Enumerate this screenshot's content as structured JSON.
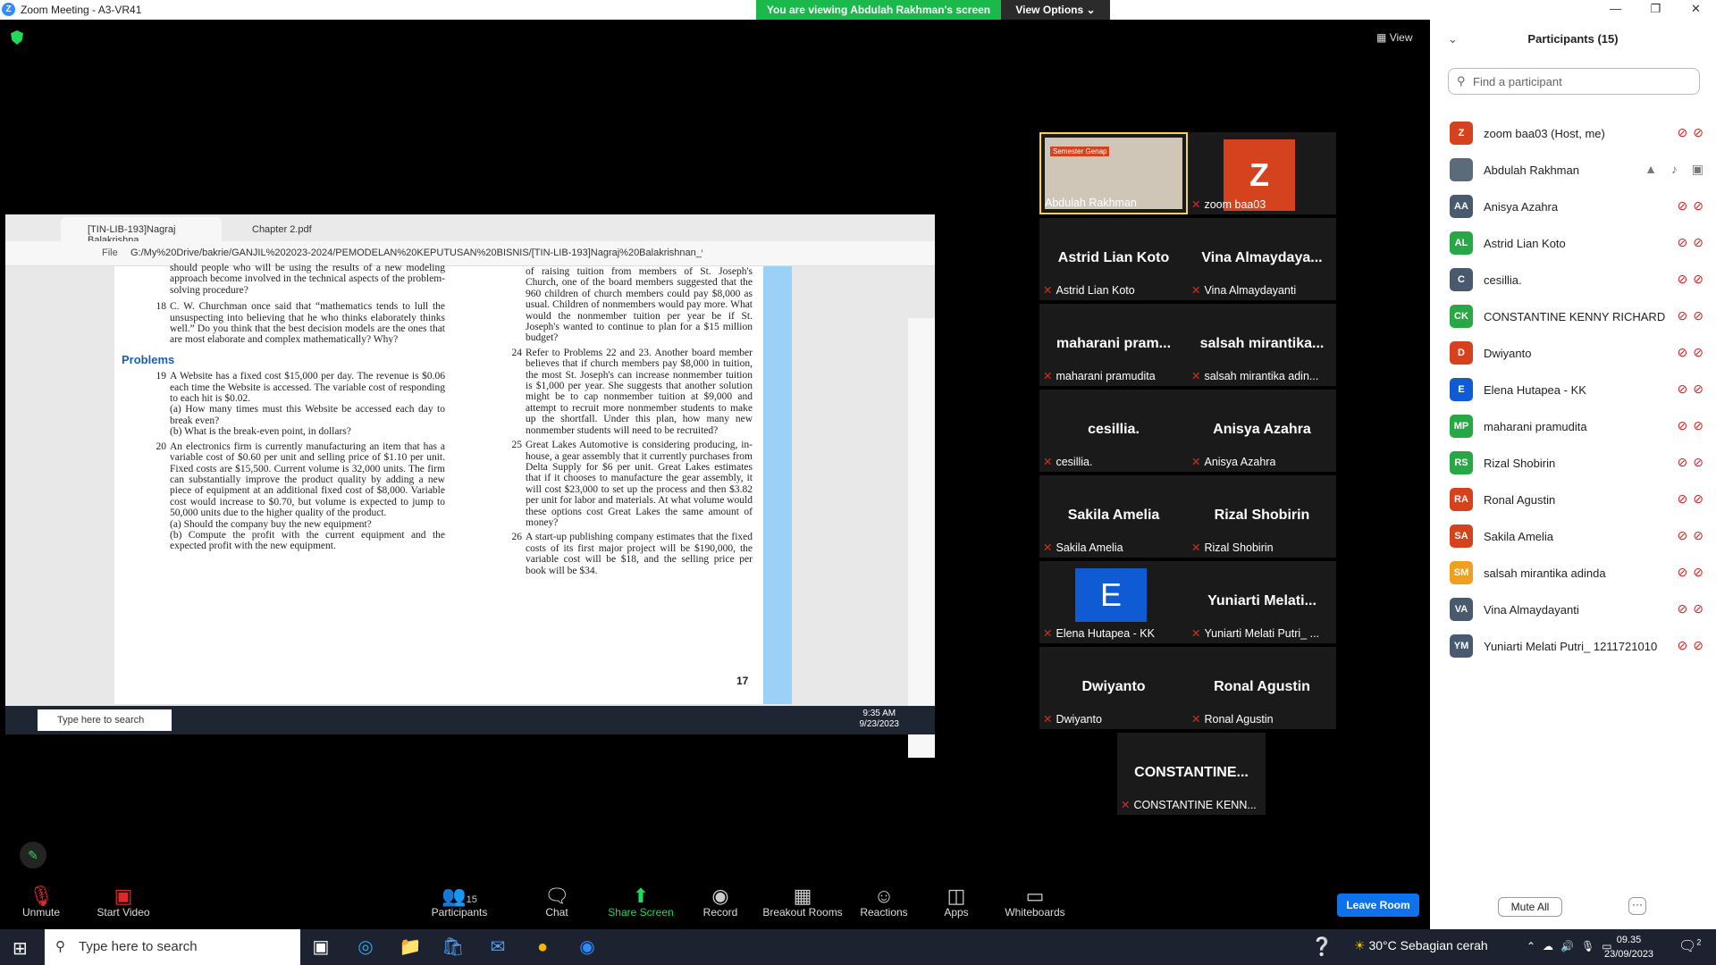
{
  "window": {
    "title": "Zoom Meeting - A3-VR41",
    "app_icon": "Z"
  },
  "banner": {
    "viewing": "You are viewing Abdulah Rakhman's screen",
    "view_options": "View Options"
  },
  "view_label": "View",
  "browser": {
    "tab1": "[TIN-LIB-193]Nagraj Balakrishna...",
    "tab2": "Chapter 2.pdf",
    "file_label": "File",
    "address": "G:/My%20Drive/bakrie/GANJIL%202023-2024/PEMODELAN%20KEPUTUSAN%20BISNIS/[TIN-LIB-193]Nagraj%20Balakrishnan_%20B..."
  },
  "pdf": {
    "left_top": "should people who will be using the results of a new modeling approach become involved in the technical aspects of the problem-solving procedure?",
    "item18_num": "18",
    "item18": "C. W. Churchman once said that “mathematics tends to lull the unsuspecting into believing that he who thinks elaborately thinks well.” Do you think that the best decision models are the ones that are most elaborate and complex mathematically? Why?",
    "problems_heading": "Problems",
    "item19_num": "19",
    "item19": "A Website has a fixed cost $15,000 per day. The revenue is $0.06 each time the Website is accessed. The variable cost of responding to each hit is $0.02.",
    "item19a": "(a) How many times must this Website be accessed each day to break even?",
    "item19b": "(b) What is the break-even point, in dollars?",
    "item20_num": "20",
    "item20": "An electronics firm is currently manufacturing an item that has a variable cost of $0.60 per unit and selling price of $1.10 per unit. Fixed costs are $15,500. Current volume is 32,000 units. The firm can substantially improve the product quality by adding a new piece of equipment at an additional fixed cost of $8,000. Variable cost would increase to $0.70, but volume is expected to jump to 50,000 units due to the higher quality of the product.",
    "item20a": "(a) Should the company buy the new equipment?",
    "item20b": "(b) Compute the profit with the current equipment and the expected profit with the new equipment.",
    "right_top": "of raising tuition from members of St. Joseph's Church, one of the board members suggested that the 960 children of church members could pay $8,000 as usual. Children of nonmembers would pay more. What would the nonmember tuition per year be if St. Joseph's wanted to continue to plan for a $15 million budget?",
    "item24_num": "24",
    "item24": "Refer to Problems 22 and 23. Another board member believes that if church members pay $8,000 in tuition, the most St. Joseph's can increase nonmember tuition is $1,000 per year. She suggests that another solution might be to cap nonmember tuition at $9,000 and attempt to recruit more nonmember students to make up the shortfall. Under this plan, how many new nonmember students will need to be recruited?",
    "item25_num": "25",
    "item25": "Great Lakes Automotive is considering producing, in-house, a gear assembly that it currently purchases from Delta Supply for $6 per unit. Great Lakes estimates that if it chooses to manufacture the gear assembly, it will cost $23,000 to set up the process and then $3.82 per unit for labor and materials. At what volume would these options cost Great Lakes the same amount of money?",
    "item26_num": "26",
    "item26": "A start-up publishing company estimates that the fixed costs of its first major project will be $190,000, the variable cost will be $18, and the selling price per book will be $34.",
    "page_number": "17"
  },
  "inner_taskbar": {
    "search": "Type here to search",
    "time": "9:35 AM",
    "date": "9/23/2023"
  },
  "gallery": [
    {
      "big": "",
      "label": "Abdulah Rakhman"
    },
    {
      "big": "Z",
      "label": "zoom baa03"
    },
    {
      "big": "Astrid Lian Koto",
      "label": "Astrid Lian Koto"
    },
    {
      "big": "Vina  Almaydaya...",
      "label": "Vina Almaydayanti"
    },
    {
      "big": "maharani  pram...",
      "label": "maharani pramudita"
    },
    {
      "big": "salsah  mirantika...",
      "label": "salsah mirantika adin..."
    },
    {
      "big": "cesillia.",
      "label": "cesillia."
    },
    {
      "big": "Anisya Azahra",
      "label": "Anisya Azahra"
    },
    {
      "big": "Sakila Amelia",
      "label": "Sakila Amelia"
    },
    {
      "big": "Rizal Shobirin",
      "label": "Rizal Shobirin"
    },
    {
      "big": "E",
      "label": "Elena Hutapea - KK"
    },
    {
      "big": "Yuniarti  Melati...",
      "label": "Yuniarti Melati Putri_ ..."
    },
    {
      "big": "Dwiyanto",
      "label": "Dwiyanto"
    },
    {
      "big": "Ronal Agustin",
      "label": "Ronal Agustin"
    },
    {
      "big": "CONSTANTINE...",
      "label": "CONSTANTINE KENN..."
    }
  ],
  "thumb_text": "Semester Genap",
  "participants": {
    "title": "Participants (15)",
    "search_placeholder": "Find a participant",
    "list": [
      {
        "initials": "Z",
        "name": "zoom baa03 (Host, me)",
        "color": "#d5431e"
      },
      {
        "initials": "",
        "name": "Abdulah Rakhman",
        "color": "#5b6b7a"
      },
      {
        "initials": "AA",
        "name": "Anisya Azahra",
        "color": "#4a5a6e"
      },
      {
        "initials": "AL",
        "name": "Astrid Lian Koto",
        "color": "#27a844"
      },
      {
        "initials": "C",
        "name": "cesillia.",
        "color": "#4a5a6e"
      },
      {
        "initials": "CK",
        "name": "CONSTANTINE KENNY RICHARD",
        "color": "#27a844"
      },
      {
        "initials": "D",
        "name": "Dwiyanto",
        "color": "#d5431e"
      },
      {
        "initials": "E",
        "name": "Elena Hutapea - KK",
        "color": "#0e5bd3"
      },
      {
        "initials": "MP",
        "name": "maharani pramudita",
        "color": "#27a844"
      },
      {
        "initials": "RS",
        "name": "Rizal Shobirin",
        "color": "#27a844"
      },
      {
        "initials": "RA",
        "name": "Ronal Agustin",
        "color": "#d5431e"
      },
      {
        "initials": "SA",
        "name": "Sakila Amelia",
        "color": "#d5431e"
      },
      {
        "initials": "SM",
        "name": "salsah mirantika adinda",
        "color": "#f0a020"
      },
      {
        "initials": "VA",
        "name": "Vina Almaydayanti",
        "color": "#4a5a6e"
      },
      {
        "initials": "YM",
        "name": "Yuniarti Melati Putri_ 1211721010",
        "color": "#4a5a6e"
      }
    ],
    "mute_all": "Mute All",
    "more": "···"
  },
  "toolbar": {
    "unmute": "Unmute",
    "start_video": "Start Video",
    "participants_count": "15",
    "participants": "Participants",
    "chat": "Chat",
    "share": "Share Screen",
    "record": "Record",
    "breakout": "Breakout Rooms",
    "reactions": "Reactions",
    "apps": "Apps",
    "whiteboards": "Whiteboards",
    "leave": "Leave Room"
  },
  "taskbar": {
    "search": "Type here to search",
    "weather": "30°C  Sebagian cerah",
    "time": "09.35",
    "date": "23/09/2023",
    "notif": "2"
  }
}
